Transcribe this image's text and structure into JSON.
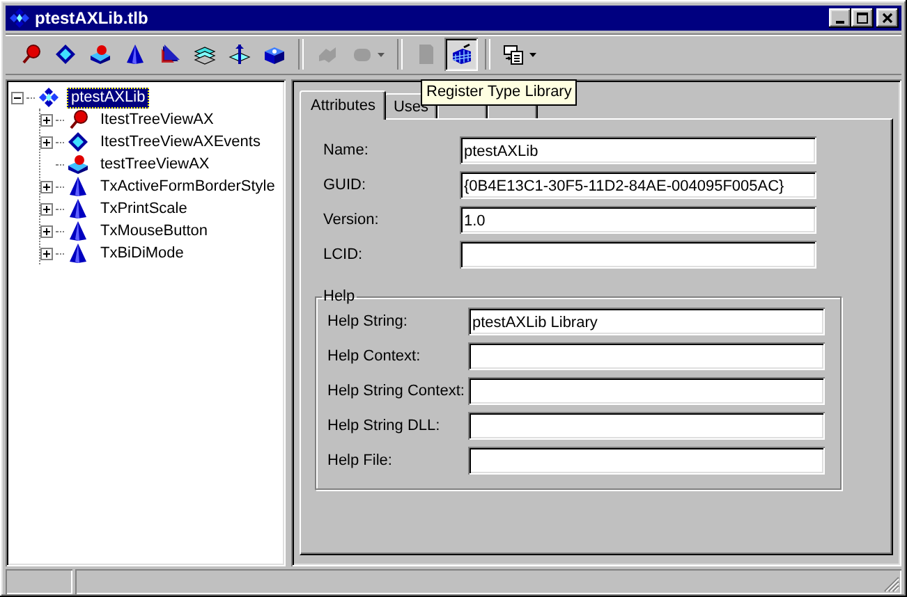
{
  "window": {
    "title": "ptestAXLib.tlb"
  },
  "toolbar": [
    {
      "kind": "interface",
      "disabled": false,
      "pressed": false,
      "dropdown": false
    },
    {
      "kind": "dispinterface",
      "disabled": false,
      "pressed": false,
      "dropdown": false
    },
    {
      "kind": "coclass",
      "disabled": false,
      "pressed": false,
      "dropdown": false
    },
    {
      "kind": "enum",
      "disabled": false,
      "pressed": false,
      "dropdown": false
    },
    {
      "kind": "alias",
      "disabled": false,
      "pressed": false,
      "dropdown": false
    },
    {
      "kind": "record",
      "disabled": false,
      "pressed": false,
      "dropdown": false
    },
    {
      "kind": "union",
      "disabled": false,
      "pressed": false,
      "dropdown": false
    },
    {
      "kind": "module",
      "disabled": false,
      "pressed": false,
      "dropdown": false
    },
    {
      "kind": "separator"
    },
    {
      "kind": "method",
      "disabled": true,
      "pressed": false,
      "dropdown": false
    },
    {
      "kind": "field",
      "disabled": true,
      "pressed": false,
      "dropdown": true
    },
    {
      "kind": "separator"
    },
    {
      "kind": "refresh",
      "disabled": true,
      "pressed": false,
      "dropdown": false
    },
    {
      "kind": "register",
      "disabled": false,
      "pressed": true,
      "dropdown": false
    },
    {
      "kind": "separator"
    },
    {
      "kind": "export",
      "disabled": false,
      "pressed": false,
      "dropdown": true
    }
  ],
  "tooltip": {
    "text": "Register Type Library"
  },
  "tree": [
    {
      "label": "ptestAXLib",
      "kind": "library",
      "selected": true,
      "expanded": true,
      "children": [
        {
          "label": "ItestTreeViewAX",
          "kind": "interface",
          "selected": false,
          "expanded": false,
          "has_children": true
        },
        {
          "label": "ItestTreeViewAXEvents",
          "kind": "dispinterface",
          "selected": false,
          "expanded": false,
          "has_children": true
        },
        {
          "label": "testTreeViewAX",
          "kind": "coclass",
          "selected": false,
          "has_children": false
        },
        {
          "label": "TxActiveFormBorderStyle",
          "kind": "enum",
          "selected": false,
          "expanded": false,
          "has_children": true
        },
        {
          "label": "TxPrintScale",
          "kind": "enum",
          "selected": false,
          "expanded": false,
          "has_children": true
        },
        {
          "label": "TxMouseButton",
          "kind": "enum",
          "selected": false,
          "expanded": false,
          "has_children": true
        },
        {
          "label": "TxBiDiMode",
          "kind": "enum",
          "selected": false,
          "expanded": false,
          "has_children": true
        }
      ],
      "has_children": true
    }
  ],
  "tabs": [
    {
      "label": "Attributes",
      "selected": true
    },
    {
      "label": "Uses",
      "selected": false
    },
    {
      "selected": false
    },
    {
      "selected": false
    }
  ],
  "fields": [
    {
      "label": "Name:",
      "value": "ptestAXLib"
    },
    {
      "label": "GUID:",
      "value": "{0B4E13C1-30F5-11D2-84AE-004095F005AC}"
    },
    {
      "label": "Version:",
      "value": "1.0"
    },
    {
      "label": "LCID:"
    }
  ],
  "help_group": {
    "title": "Help",
    "fields": [
      {
        "label": "Help String:",
        "value": "ptestAXLib Library"
      },
      {
        "label": "Help Context:"
      },
      {
        "label": "Help String Context:"
      },
      {
        "label": "Help String DLL:"
      },
      {
        "label": "Help File:"
      }
    ]
  }
}
